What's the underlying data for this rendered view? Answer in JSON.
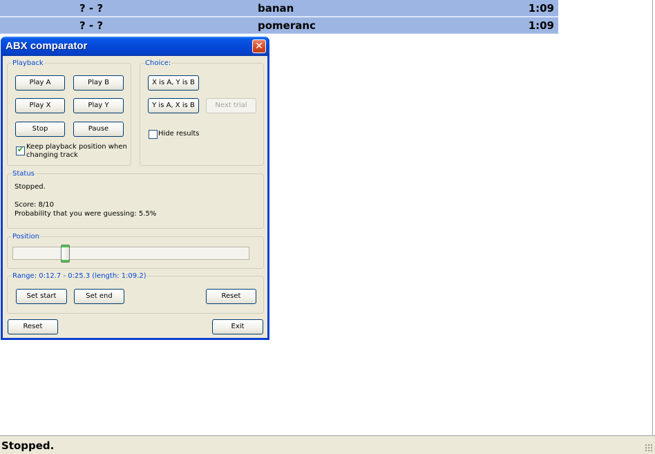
{
  "playlist": {
    "rows": [
      {
        "artist": "? - ?",
        "title": "banan",
        "length": "1:09"
      },
      {
        "artist": "? - ?",
        "title": "pomeranc",
        "length": "1:09"
      }
    ]
  },
  "dialog": {
    "title": "ABX comparator",
    "close_icon": "close-icon",
    "playback": {
      "legend": "Playback",
      "play_a": "Play A",
      "play_b": "Play B",
      "play_x": "Play X",
      "play_y": "Play Y",
      "stop": "Stop",
      "pause": "Pause",
      "keep_position_line1": "Keep playback position when",
      "keep_position_line2": "changing track",
      "keep_position_checked": true
    },
    "choice": {
      "legend": "Choice:",
      "x_is_a": "X is A, Y is B",
      "y_is_a": "Y is A, X is B",
      "next_trial": "Next trial",
      "hide_results": "Hide results",
      "hide_results_checked": false
    },
    "status": {
      "legend": "Status",
      "state": "Stopped.",
      "score": "Score: 8/10",
      "probability": "Probability that you were guessing: 5.5%"
    },
    "position": {
      "legend": "Position",
      "value_fraction": 0.21
    },
    "range": {
      "legend": "Range: 0:12.7 - 0:25.3 (length: 1:09.2)",
      "set_start": "Set start",
      "set_end": "Set end",
      "reset": "Reset"
    },
    "footer": {
      "reset": "Reset",
      "exit": "Exit"
    }
  },
  "statusbar": {
    "text": "Stopped."
  },
  "colors": {
    "selection_row": "#9db5e3",
    "titlebar": "#0548d8",
    "dialog_bg": "#ece9d8",
    "legend": "#0046d5"
  }
}
